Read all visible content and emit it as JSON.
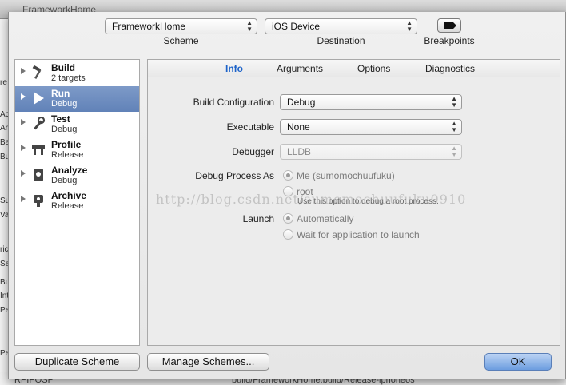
{
  "background": {
    "window_title": "FrameworkHome",
    "bottom_left": "RPIPOSP",
    "bottom_path": "build/FrameworkHome.build/Release-iphoneos",
    "left_fragments": [
      "re",
      "Ac",
      "Ar",
      "Ba",
      "Bu",
      "Su",
      "Va",
      "ric",
      "Se",
      "Bu",
      "Int",
      "Pe",
      "Pe"
    ]
  },
  "toolbar": {
    "scheme_value": "FrameworkHome",
    "scheme_label": "Scheme",
    "destination_value": "iOS Device",
    "destination_label": "Destination",
    "breakpoints_label": "Breakpoints"
  },
  "actions": [
    {
      "name": "Build",
      "sub": "2 targets",
      "icon": "hammer-icon",
      "selected": false
    },
    {
      "name": "Run",
      "sub": "Debug",
      "icon": "play-icon",
      "selected": true
    },
    {
      "name": "Test",
      "sub": "Debug",
      "icon": "wrench-icon",
      "selected": false
    },
    {
      "name": "Profile",
      "sub": "Release",
      "icon": "instruments-icon",
      "selected": false
    },
    {
      "name": "Analyze",
      "sub": "Debug",
      "icon": "analyze-icon",
      "selected": false
    },
    {
      "name": "Archive",
      "sub": "Release",
      "icon": "archive-icon",
      "selected": false
    }
  ],
  "tabs": [
    "Info",
    "Arguments",
    "Options",
    "Diagnostics"
  ],
  "form": {
    "build_configuration_label": "Build Configuration",
    "build_configuration_value": "Debug",
    "executable_label": "Executable",
    "executable_value": "None",
    "debugger_label": "Debugger",
    "debugger_value": "LLDB",
    "debug_process_label": "Debug Process As",
    "debug_process_me": "Me (sumomochuufuku)",
    "debug_process_root": "root",
    "debug_process_root_desc": "Use this option to debug a root process.",
    "launch_label": "Launch",
    "launch_auto": "Automatically",
    "launch_wait": "Wait for application to launch"
  },
  "watermark": "http://blog.csdn.net/sumomochuufuku0910",
  "buttons": {
    "duplicate": "Duplicate Scheme",
    "manage": "Manage Schemes...",
    "ok": "OK"
  },
  "colors": {
    "selection": "#6b8cc2",
    "active_tab": "#1d63c9",
    "default_button": "#6c9de0"
  }
}
